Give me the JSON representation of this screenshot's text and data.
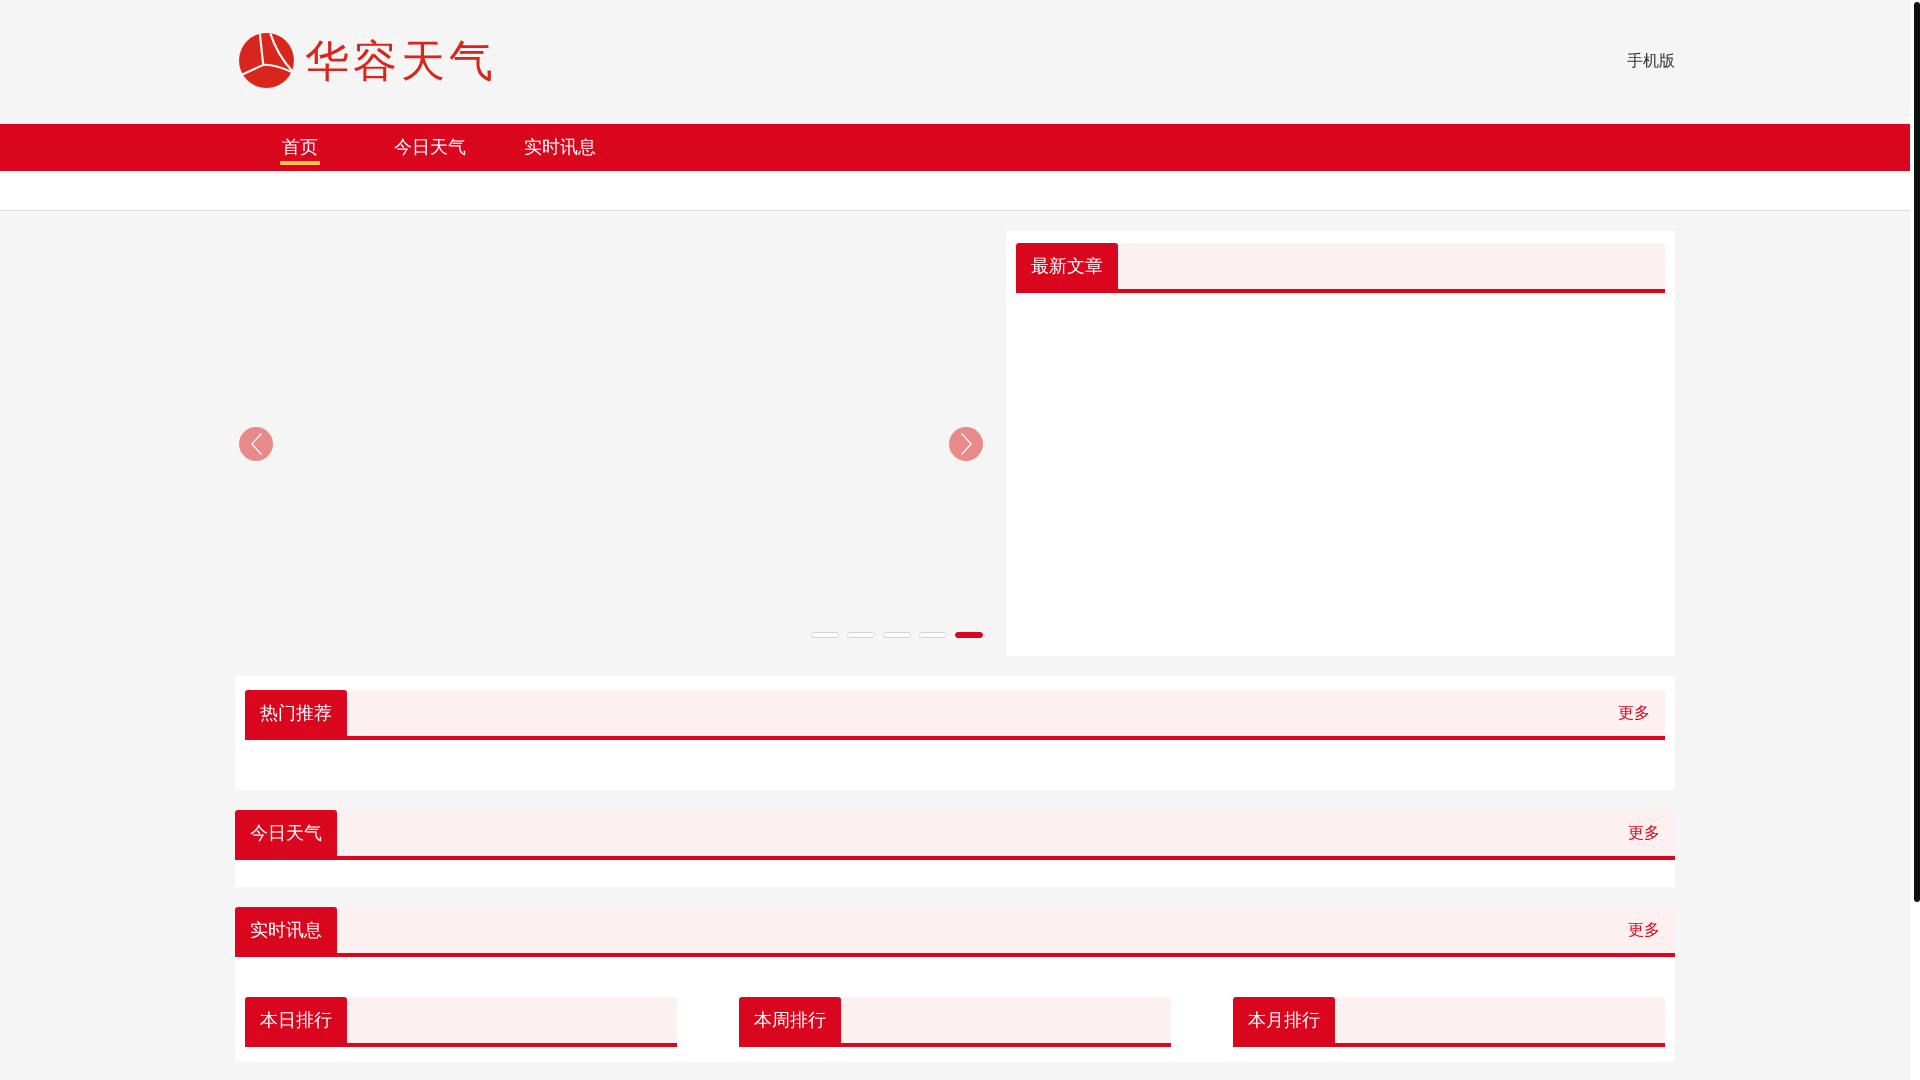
{
  "header": {
    "logo_text": "华容天气",
    "mobile_link": "手机版"
  },
  "nav": [
    {
      "label": "首页",
      "selected": true
    },
    {
      "label": "今日天气",
      "selected": false
    },
    {
      "label": "实时讯息",
      "selected": false
    }
  ],
  "carousel": {
    "dots": [
      {
        "selected": false
      },
      {
        "selected": false
      },
      {
        "selected": false
      },
      {
        "selected": false
      },
      {
        "selected": true
      }
    ]
  },
  "latest_articles": {
    "title": "最新文章"
  },
  "sections": [
    {
      "kind": "inset",
      "title": "热门推荐",
      "more": "更多"
    },
    {
      "kind": "flush",
      "title": "今日天气",
      "more": "更多"
    },
    {
      "kind": "flush",
      "title": "实时讯息",
      "more": "更多",
      "rankings": [
        {
          "title": "本日排行"
        },
        {
          "title": "本周排行"
        },
        {
          "title": "本月排行"
        }
      ]
    }
  ]
}
